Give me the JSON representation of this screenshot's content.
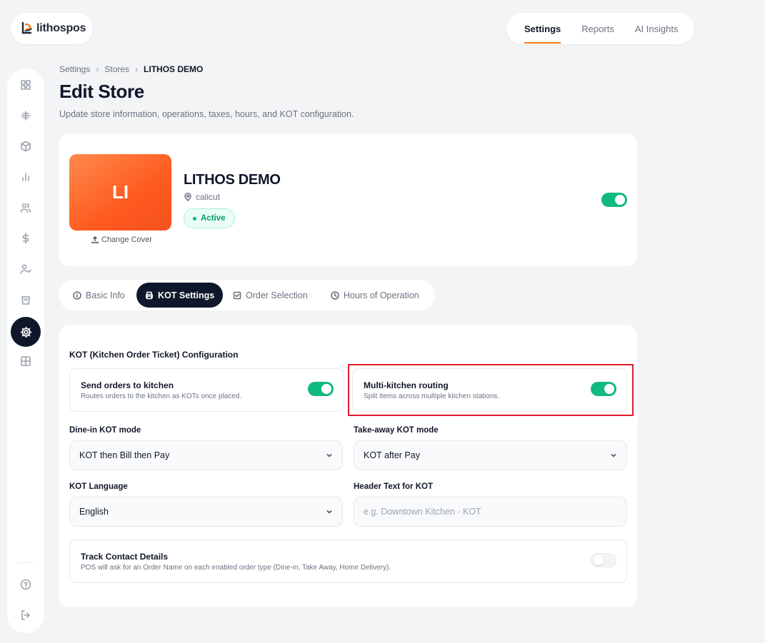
{
  "brand": {
    "name": "lithospos"
  },
  "topnav": {
    "items": [
      "Settings",
      "Reports",
      "AI Insights"
    ],
    "active": "Settings"
  },
  "sidebar": {
    "icons": [
      "dashboard-icon",
      "hash-icon",
      "box-icon",
      "chart-icon",
      "users-icon",
      "dollar-icon",
      "user-check-icon",
      "bag-icon",
      "gear-icon",
      "grid-icon",
      "help-icon",
      "logout-icon"
    ],
    "active": "gear-icon"
  },
  "breadcrumb": {
    "items": [
      "Settings",
      "Stores",
      "LITHOS DEMO"
    ],
    "separator": "›"
  },
  "page": {
    "title": "Edit Store",
    "subtitle": "Update store information, operations, taxes, hours, and KOT configuration."
  },
  "store": {
    "initials": "LI",
    "change_cover": "Change Cover",
    "name": "LITHOS DEMO",
    "location": "calicut",
    "status": "Active",
    "enabled": true
  },
  "tabs": [
    {
      "label": "Basic Info",
      "icon": "info-icon",
      "active": false
    },
    {
      "label": "KOT Settings",
      "icon": "printer-icon",
      "active": true
    },
    {
      "label": "Order Selection",
      "icon": "checkbox-icon",
      "active": false
    },
    {
      "label": "Hours of Operation",
      "icon": "clock-icon",
      "active": false
    }
  ],
  "kot": {
    "section_title": "KOT (Kitchen Order Ticket) Configuration",
    "send_orders": {
      "title": "Send orders to kitchen",
      "desc": "Routes orders to the kitchen as KOTs once placed.",
      "enabled": true
    },
    "multi_kitchen": {
      "title": "Multi-kitchen routing",
      "desc": "Split items across multiple kitchen stations.",
      "enabled": true
    },
    "dine_in": {
      "label": "Dine-in KOT mode",
      "value": "KOT then Bill then Pay"
    },
    "take_away": {
      "label": "Take-away KOT mode",
      "value": "KOT after Pay"
    },
    "language": {
      "label": "KOT Language",
      "value": "English"
    },
    "header_text": {
      "label": "Header Text for KOT",
      "value": "",
      "placeholder": "e.g. Downtown Kitchen - KOT"
    },
    "track_contact": {
      "title": "Track Contact Details",
      "desc": "POS will ask for an Order Name on each enabled order type (Dine-in, Take Away, Home Delivery).",
      "enabled": false
    }
  },
  "colors": {
    "accent": "#f97316",
    "toggle_on": "#10b981",
    "dark": "#0f172a",
    "highlight": "#e11d2e"
  }
}
